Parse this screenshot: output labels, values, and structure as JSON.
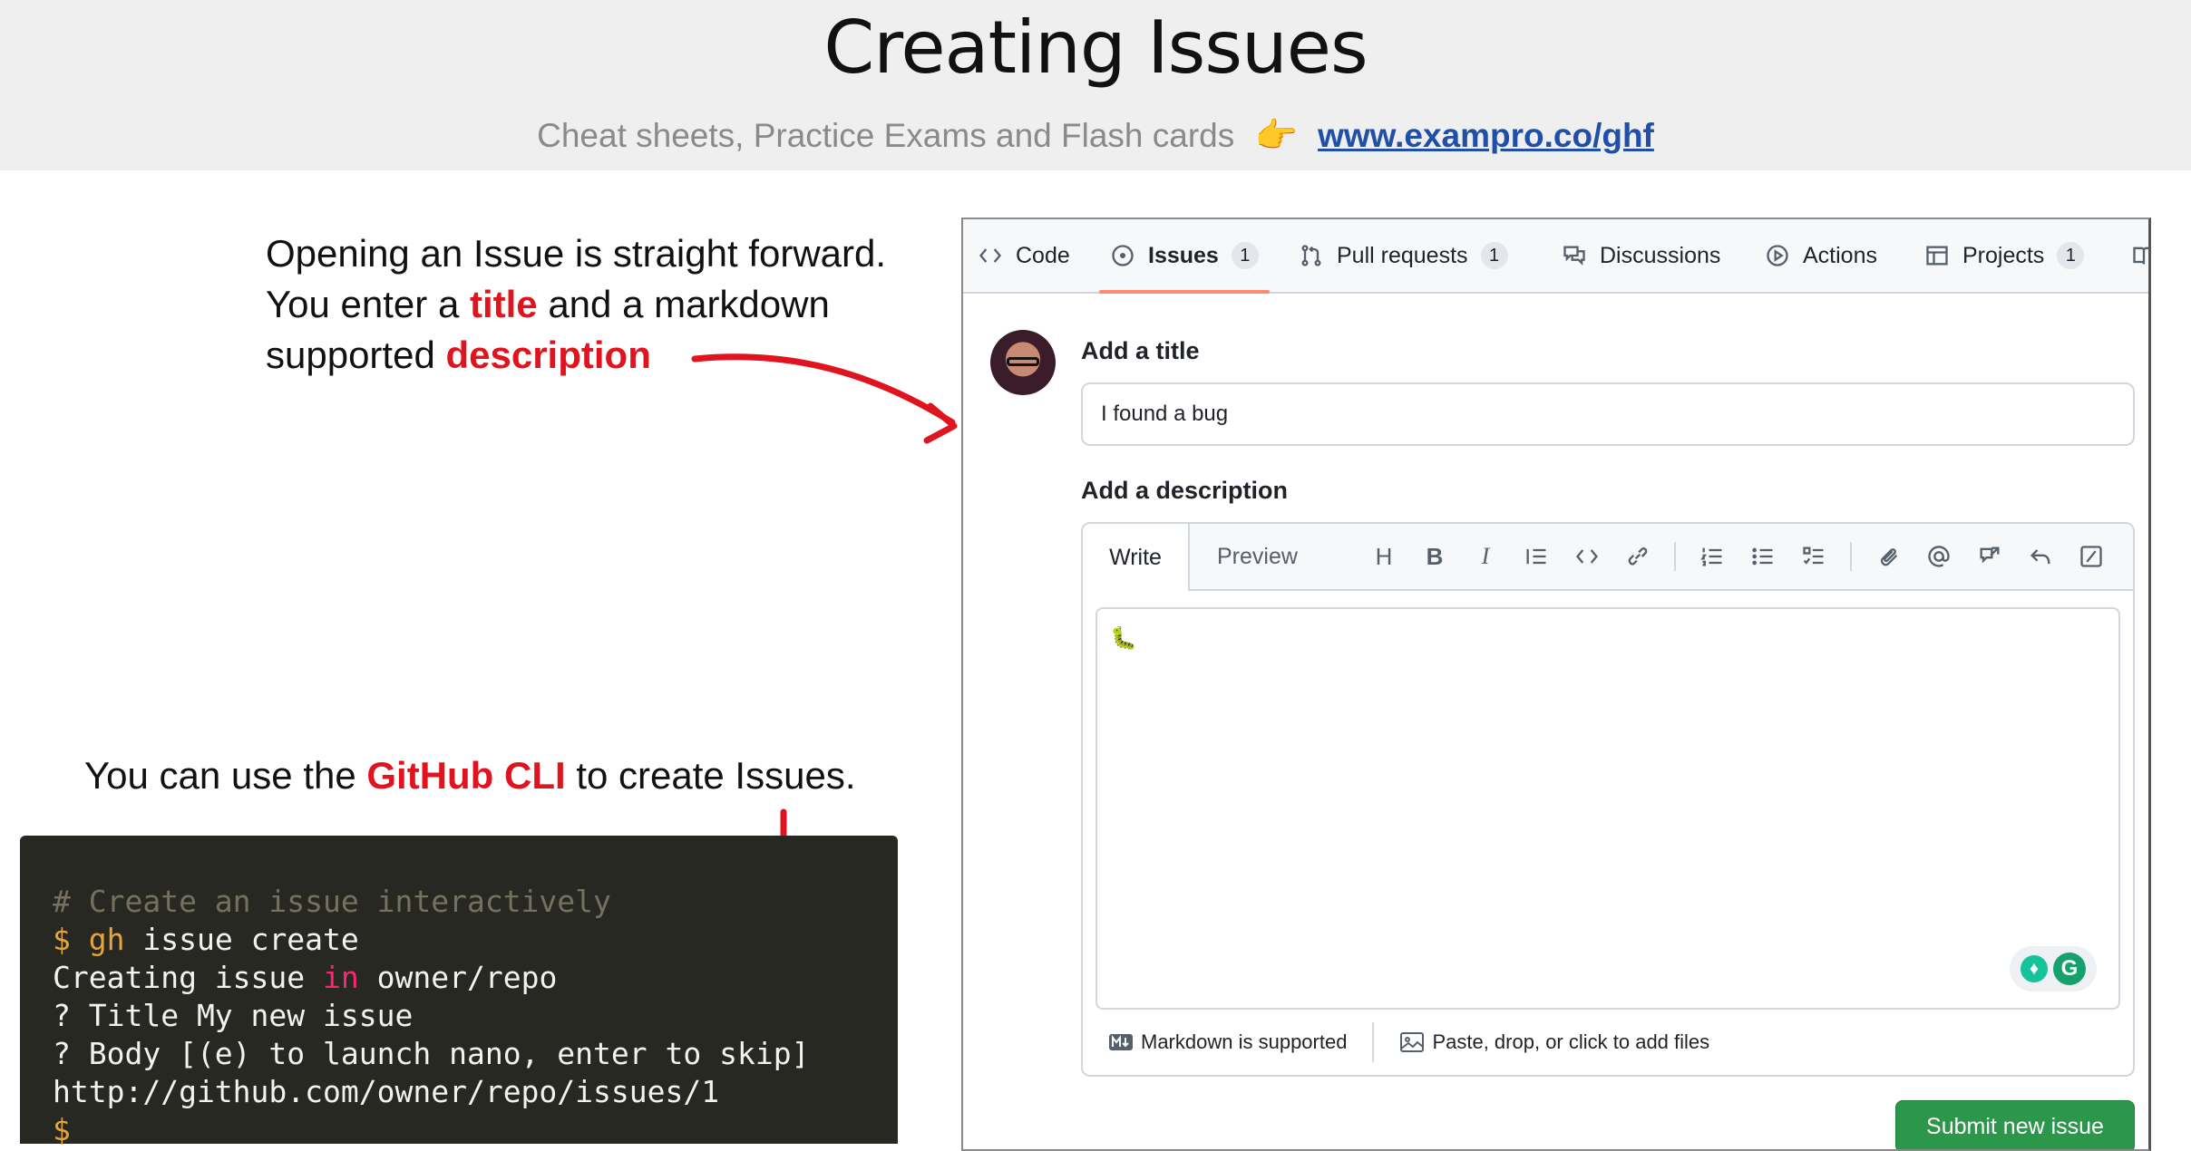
{
  "slide": {
    "title": "Creating Issues",
    "subtitle_text": "Cheat sheets, Practice Exams and Flash cards",
    "subtitle_icon": "pointing-hand-icon",
    "subtitle_link": "www.exampro.co/ghf"
  },
  "note": {
    "line1": "Opening an Issue is straight forward.",
    "line2_a": "You enter a ",
    "line2_b": "title",
    "line2_c": " and a markdown",
    "line3_a": "supported ",
    "line3_b": "description"
  },
  "cli_note": {
    "a": "You can use the ",
    "b": "GitHub CLI",
    "c": " to create Issues."
  },
  "terminal": {
    "comment": "# Create an issue interactively",
    "prompt1": "$ ",
    "cmd_gh": "gh",
    "cmd_rest": " issue create",
    "line3_a": "Creating issue ",
    "line3_kw": "in",
    "line3_b": " owner/repo",
    "line4": "? Title My new issue",
    "line5": "? Body [(e) to launch nano, enter to skip]",
    "line6": "http://github.com/owner/repo/issues/1",
    "prompt2": "$"
  },
  "github": {
    "tabs": [
      {
        "label": "Code",
        "icon": "code-icon"
      },
      {
        "label": "Issues",
        "count": "1",
        "icon": "issue-opened-icon",
        "active": true
      },
      {
        "label": "Pull requests",
        "count": "1",
        "icon": "pull-request-icon"
      },
      {
        "label": "Discussions",
        "icon": "discussions-icon"
      },
      {
        "label": "Actions",
        "icon": "play-icon"
      },
      {
        "label": "Projects",
        "count": "1",
        "icon": "table-icon"
      }
    ],
    "title_label": "Add a title",
    "title_value": "I found a bug",
    "desc_label": "Add a description",
    "editor_tabs": {
      "write": "Write",
      "preview": "Preview"
    },
    "toolbar_icons": [
      "heading-icon",
      "bold-icon",
      "italic-icon",
      "quote-icon",
      "code-icon",
      "link-icon",
      "ordered-list-icon",
      "unordered-list-icon",
      "task-list-icon",
      "attach-icon",
      "mention-icon",
      "reference-icon",
      "undo-icon",
      "slash-command-icon"
    ],
    "footer_markdown": "Markdown is supported",
    "footer_files": "Paste, drop, or click to add files",
    "submit": "Submit new issue"
  },
  "colors": {
    "accent_red": "#e0141e",
    "submit_green": "#2c974b",
    "tab_underline": "#fd8c73",
    "link_blue": "#1f4fa8"
  }
}
